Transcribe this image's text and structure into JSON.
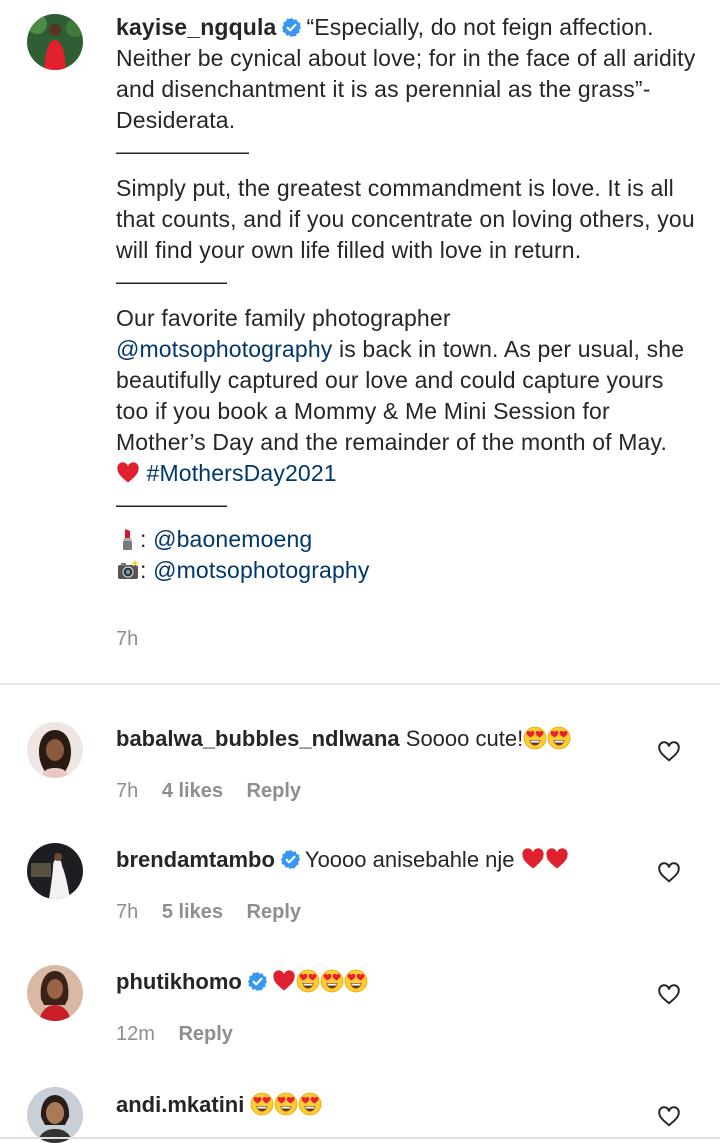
{
  "post": {
    "username": "kayise_ngqula",
    "quote": "“Especially, do not feign affection. Neither be cynical about love; for in the face of all aridity and disenchantment it is as perennial as the grass”- Desiderata.",
    "divider1": "——————",
    "paragraph2": "Simply put, the greatest commandment is love. It is all that counts, and if you concentrate on loving others, you will find your own life filled with love in return.",
    "divider2": "—————",
    "p3_before": "Our favorite family photographer",
    "p3_mention": "@motsophotography",
    "p3_after": " is back in town. As per usual, she beautifully captured our love and could capture yours too if you book a Mommy & Me Mini Session for Mother’s Day and the remainder of the month of May.",
    "hashtag": "#MothersDay2021",
    "divider3": "—————",
    "makeup_credit": "@baonemoeng",
    "photo_credit": "@motsophotography",
    "time": "7h"
  },
  "comments": [
    {
      "username": "babalwa_bubbles_ndlwana",
      "text": "Soooo cute!",
      "time": "7h",
      "likes": "4 likes",
      "reply": "Reply",
      "verified": false
    },
    {
      "username": "brendamtambo",
      "text": "Yoooo anisebahle nje",
      "time": "7h",
      "likes": "5 likes",
      "reply": "Reply",
      "verified": true
    },
    {
      "username": "phutikhomo",
      "text": "",
      "time": "12m",
      "likes": "",
      "reply": "Reply",
      "verified": true
    },
    {
      "username": "andi.mkatini",
      "text": "",
      "time": "",
      "likes": "",
      "reply": "",
      "verified": false
    }
  ],
  "icons": {
    "verified": "verified-badge-icon",
    "like": "heart-outline-icon",
    "red_heart": "red-heart-emoji",
    "heart_eyes": "heart-eyes-emoji",
    "lipstick": "lipstick-emoji",
    "camera": "camera-flash-emoji"
  },
  "colors": {
    "verified_blue": "#3897f0",
    "link_blue": "#00376b",
    "muted_gray": "#8e8e8e",
    "heart_red": "#e0202e"
  }
}
